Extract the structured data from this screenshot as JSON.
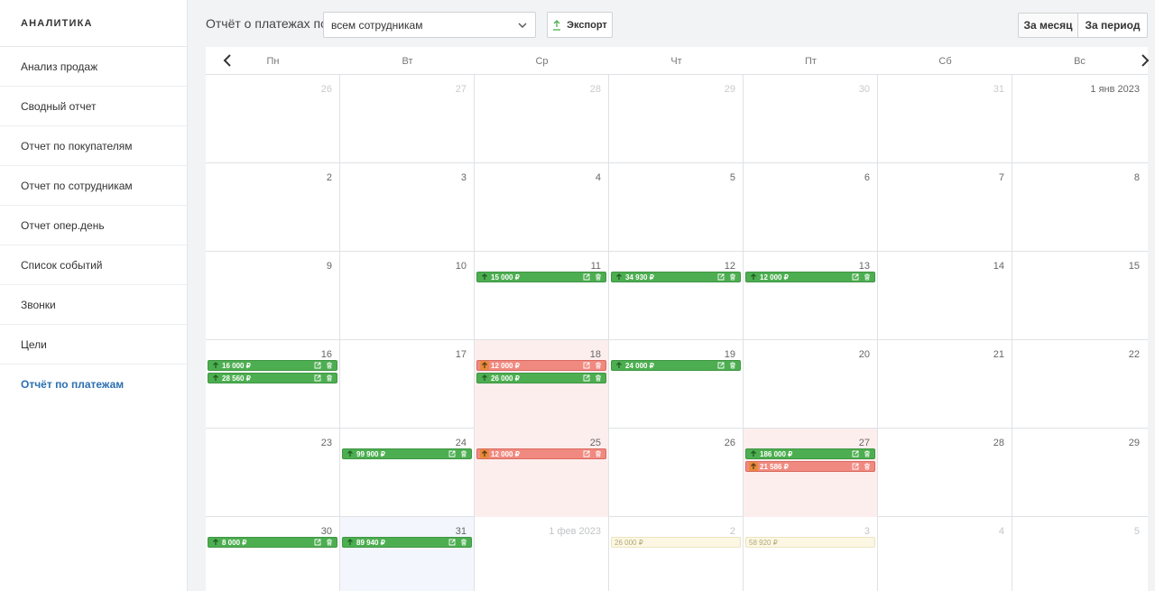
{
  "sidebar": {
    "title": "АНАЛИТИКА",
    "items": [
      {
        "label": "Анализ продаж"
      },
      {
        "label": "Сводный отчет"
      },
      {
        "label": "Отчет по покупателям"
      },
      {
        "label": "Отчет по сотрудникам"
      },
      {
        "label": "Отчет опер.день"
      },
      {
        "label": "Список событий"
      },
      {
        "label": "Звонки"
      },
      {
        "label": "Цели"
      },
      {
        "label": "Отчёт по платежам",
        "active": true
      }
    ]
  },
  "toolbar": {
    "report_label": "Отчёт о платежах по",
    "employee_select_value": "всем сотрудникам",
    "export_label": "Экспорт",
    "month_label": "За месяц",
    "period_label": "За период"
  },
  "calendar": {
    "weekdays": [
      "Пн",
      "Вт",
      "Ср",
      "Чт",
      "Пт",
      "Сб",
      "Вс"
    ],
    "weeks": [
      [
        {
          "label": "26",
          "muted": true
        },
        {
          "label": "27",
          "muted": true
        },
        {
          "label": "28",
          "muted": true
        },
        {
          "label": "29",
          "muted": true
        },
        {
          "label": "30",
          "muted": true
        },
        {
          "label": "31",
          "muted": true
        },
        {
          "label": "1 янв 2023"
        }
      ],
      [
        {
          "label": "2"
        },
        {
          "label": "3"
        },
        {
          "label": "4"
        },
        {
          "label": "5"
        },
        {
          "label": "6"
        },
        {
          "label": "7"
        },
        {
          "label": "8"
        }
      ],
      [
        {
          "label": "9"
        },
        {
          "label": "10"
        },
        {
          "label": "11",
          "events": [
            {
              "amount": "15 000 ₽",
              "kind": "in"
            }
          ]
        },
        {
          "label": "12",
          "events": [
            {
              "amount": "34 930 ₽",
              "kind": "in"
            }
          ]
        },
        {
          "label": "13",
          "events": [
            {
              "amount": "12 000 ₽",
              "kind": "in"
            }
          ]
        },
        {
          "label": "14"
        },
        {
          "label": "15"
        }
      ],
      [
        {
          "label": "16",
          "events": [
            {
              "amount": "16 000 ₽",
              "kind": "in"
            },
            {
              "amount": "28 560 ₽",
              "kind": "in"
            }
          ]
        },
        {
          "label": "17"
        },
        {
          "label": "18",
          "highlight": "negative",
          "events": [
            {
              "amount": "12 000 ₽",
              "kind": "out"
            },
            {
              "amount": "26 000 ₽",
              "kind": "in"
            }
          ]
        },
        {
          "label": "19",
          "events": [
            {
              "amount": "24 000 ₽",
              "kind": "in"
            }
          ]
        },
        {
          "label": "20"
        },
        {
          "label": "21"
        },
        {
          "label": "22"
        }
      ],
      [
        {
          "label": "23"
        },
        {
          "label": "24",
          "events": [
            {
              "amount": "99 900 ₽",
              "kind": "in"
            }
          ]
        },
        {
          "label": "25",
          "highlight": "negative",
          "events": [
            {
              "amount": "12 000 ₽",
              "kind": "out"
            }
          ]
        },
        {
          "label": "26"
        },
        {
          "label": "27",
          "highlight": "negative",
          "events": [
            {
              "amount": "186 000 ₽",
              "kind": "in"
            },
            {
              "amount": "21 586 ₽",
              "kind": "out"
            }
          ]
        },
        {
          "label": "28"
        },
        {
          "label": "29"
        }
      ],
      [
        {
          "label": "30",
          "events": [
            {
              "amount": "8 000 ₽",
              "kind": "in"
            }
          ]
        },
        {
          "label": "31",
          "today": true,
          "events": [
            {
              "amount": "89 940 ₽",
              "kind": "in"
            }
          ]
        },
        {
          "label": "1 фев 2023",
          "outside": true
        },
        {
          "label": "2",
          "outside": true,
          "events": [
            {
              "amount": "26 000 ₽",
              "kind": "planned"
            }
          ]
        },
        {
          "label": "3",
          "outside": true,
          "events": [
            {
              "amount": "58 920 ₽",
              "kind": "planned"
            }
          ]
        },
        {
          "label": "4",
          "outside": true
        },
        {
          "label": "5",
          "outside": true
        }
      ]
    ]
  },
  "colors": {
    "income": "#4cae50",
    "expense": "#f08a80",
    "expense_arrow": "#e8893a",
    "planned": "#fbf7e3",
    "negative_day": "#fdeeee",
    "accent": "#2b6fb0"
  }
}
